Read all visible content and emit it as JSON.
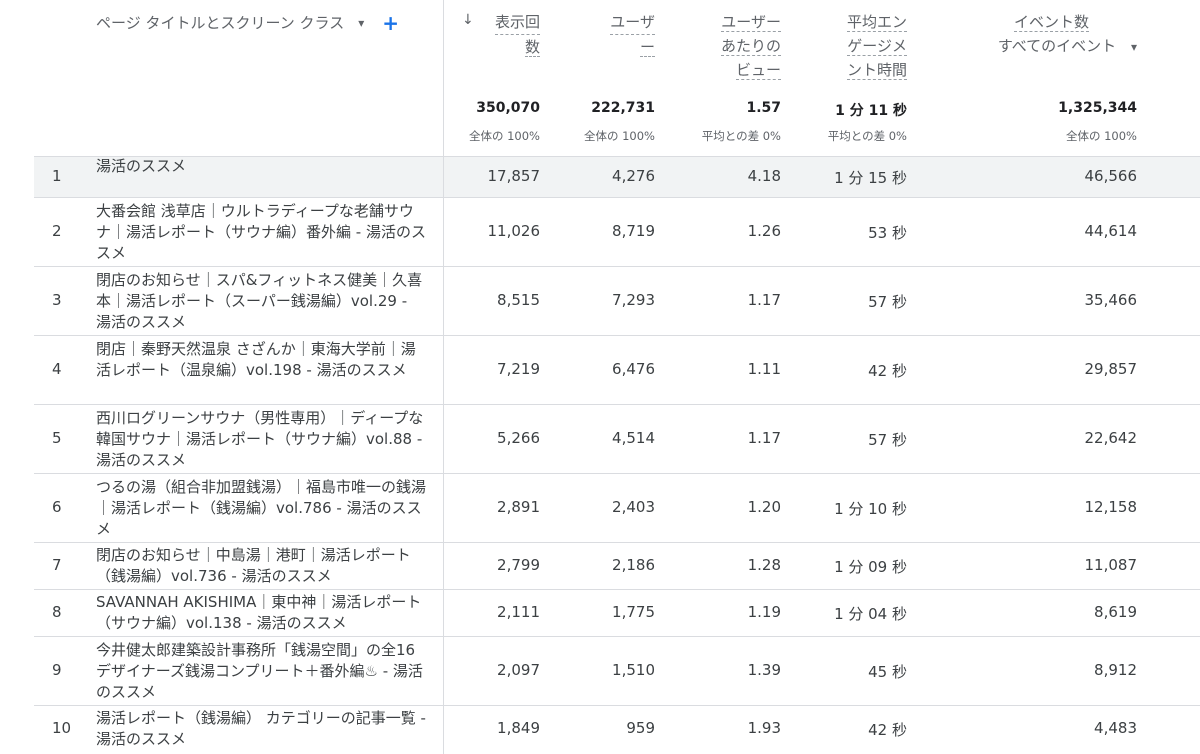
{
  "header": {
    "dimension": "ページ タイトルとスクリーン クラス",
    "dimension_caret": "▾",
    "add_label": "+",
    "sort_icon": "↓",
    "columns": [
      {
        "lines": [
          "表示回",
          "数"
        ]
      },
      {
        "lines": [
          "ユーザ",
          "ー"
        ]
      },
      {
        "lines": [
          "ユーザー",
          "あたりの",
          "ビュー"
        ]
      },
      {
        "lines": [
          "平均エン",
          "ゲージメ",
          "ント時間"
        ]
      },
      {
        "lines": [
          "イベント数",
          "すべてのイベント"
        ]
      }
    ],
    "event_caret": "▾"
  },
  "totals": {
    "values": [
      "350,070",
      "222,731",
      "1.57",
      "1 分 11 秒",
      "1,325,344"
    ],
    "sub": [
      "全体の 100%",
      "全体の 100%",
      "平均との差 0%",
      "平均との差 0%",
      "全体の 100%"
    ]
  },
  "rows": [
    {
      "idx": "1",
      "title": "湯活のススメ",
      "v": [
        "17,857",
        "4,276",
        "4.18",
        "1 分 15 秒",
        "46,566"
      ]
    },
    {
      "idx": "2",
      "title": "大番会館 浅草店｜ウルトラディープな老舗サウナ｜湯活レポート（サウナ編）番外編 - 湯活のススメ",
      "v": [
        "11,026",
        "8,719",
        "1.26",
        "53 秒",
        "44,614"
      ]
    },
    {
      "idx": "3",
      "title": "閉店のお知らせ｜スパ&フィットネス健美｜久喜本｜湯活レポート（スーパー銭湯編）vol.29 - 湯活のススメ",
      "v": [
        "8,515",
        "7,293",
        "1.17",
        "57 秒",
        "35,466"
      ]
    },
    {
      "idx": "4",
      "title": "閉店｜秦野天然温泉 さざんか｜東海大学前｜湯活レポート（温泉編）vol.198 - 湯活のススメ",
      "v": [
        "7,219",
        "6,476",
        "1.11",
        "42 秒",
        "29,857"
      ]
    },
    {
      "idx": "5",
      "title": "西川ログリーンサウナ（男性専用）｜ディープな韓国サウナ｜湯活レポート（サウナ編）vol.88 - 湯活のススメ",
      "v": [
        "5,266",
        "4,514",
        "1.17",
        "57 秒",
        "22,642"
      ]
    },
    {
      "idx": "6",
      "title": "つるの湯（組合非加盟銭湯）｜福島市唯一の銭湯｜湯活レポート（銭湯編）vol.786 - 湯活のススメ",
      "v": [
        "2,891",
        "2,403",
        "1.20",
        "1 分 10 秒",
        "12,158"
      ]
    },
    {
      "idx": "7",
      "title": "閉店のお知らせ｜中島湯｜港町｜湯活レポート（銭湯編）vol.736 - 湯活のススメ",
      "v": [
        "2,799",
        "2,186",
        "1.28",
        "1 分 09 秒",
        "11,087"
      ]
    },
    {
      "idx": "8",
      "title": "SAVANNAH AKISHIMA｜東中神｜湯活レポート（サウナ編）vol.138 - 湯活のススメ",
      "v": [
        "2,111",
        "1,775",
        "1.19",
        "1 分 04 秒",
        "8,619"
      ]
    },
    {
      "idx": "9",
      "title": "今井健太郎建築設計事務所「銭湯空間」の全16デザイナーズ銭湯コンプリート＋番外編♨ - 湯活のススメ",
      "v": [
        "2,097",
        "1,510",
        "1.39",
        "45 秒",
        "8,912"
      ]
    },
    {
      "idx": "10",
      "title": "湯活レポート（銭湯編） カテゴリーの記事一覧 - 湯活のススメ",
      "v": [
        "1,849",
        "959",
        "1.93",
        "42 秒",
        "4,483"
      ]
    }
  ]
}
